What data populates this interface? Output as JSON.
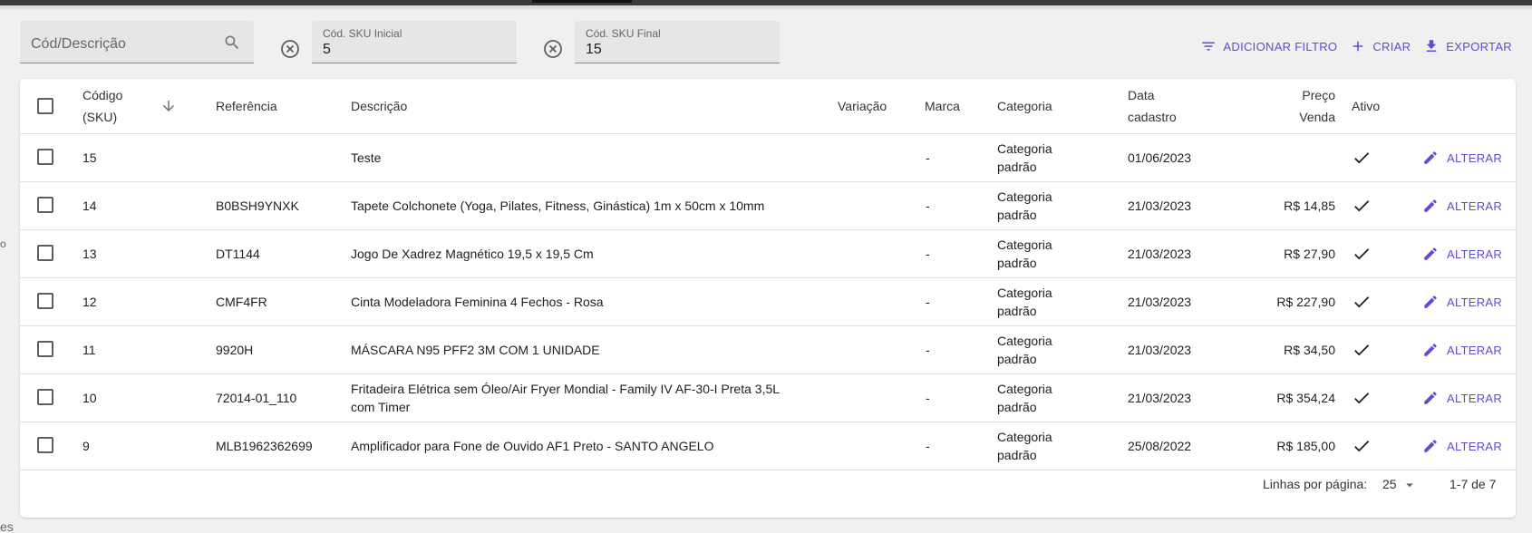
{
  "filters": {
    "search": {
      "placeholder": "Cód/Descrição"
    },
    "sku_start": {
      "label": "Cód. SKU Inicial",
      "value": "5"
    },
    "sku_end": {
      "label": "Cód. SKU Final",
      "value": "15"
    }
  },
  "actions": {
    "add_filter": "ADICIONAR FILTRO",
    "create": "CRIAR",
    "export": "EXPORTAR"
  },
  "side_fragments": {
    "fragment_1": "o",
    "fragment_2": "es"
  },
  "table": {
    "headers": {
      "code_line1": "Código",
      "code_line2": "(SKU)",
      "reference": "Referência",
      "description": "Descrição",
      "variation": "Variação",
      "brand": "Marca",
      "category": "Categoria",
      "date_line1": "Data",
      "date_line2": "cadastro",
      "price_line1": "Preço",
      "price_line2": "Venda",
      "active": "Ativo"
    },
    "rows": [
      {
        "code": "15",
        "reference": "",
        "description_l1": "Teste",
        "description_l2": "",
        "brand": "-",
        "category_l1": "Categoria",
        "category_l2": "padrão",
        "date": "01/06/2023",
        "price": "",
        "active": true,
        "action": "ALTERAR"
      },
      {
        "code": "14",
        "reference": "B0BSH9YNXK",
        "description_l1": "Tapete Colchonete (Yoga, Pilates, Fitness, Ginástica) 1m x 50cm x 10mm",
        "description_l2": "",
        "brand": "-",
        "category_l1": "Categoria",
        "category_l2": "padrão",
        "date": "21/03/2023",
        "price": "R$ 14,85",
        "active": true,
        "action": "ALTERAR"
      },
      {
        "code": "13",
        "reference": "DT1144",
        "description_l1": "Jogo De Xadrez Magnético 19,5 x 19,5 Cm",
        "description_l2": "",
        "brand": "-",
        "category_l1": "Categoria",
        "category_l2": "padrão",
        "date": "21/03/2023",
        "price": "R$ 27,90",
        "active": true,
        "action": "ALTERAR"
      },
      {
        "code": "12",
        "reference": "CMF4FR",
        "description_l1": "Cinta Modeladora Feminina 4 Fechos - Rosa",
        "description_l2": "",
        "brand": "-",
        "category_l1": "Categoria",
        "category_l2": "padrão",
        "date": "21/03/2023",
        "price": "R$ 227,90",
        "active": true,
        "action": "ALTERAR"
      },
      {
        "code": "11",
        "reference": "9920H",
        "description_l1": "MÁSCARA N95 PFF2 3M COM 1 UNIDADE",
        "description_l2": "",
        "brand": "-",
        "category_l1": "Categoria",
        "category_l2": "padrão",
        "date": "21/03/2023",
        "price": "R$ 34,50",
        "active": true,
        "action": "ALTERAR"
      },
      {
        "code": "10",
        "reference": "72014-01_110",
        "description_l1": "Fritadeira Elétrica sem Óleo/Air Fryer Mondial - Family IV AF-30-I Preta 3,5L",
        "description_l2": "com Timer",
        "brand": "-",
        "category_l1": "Categoria",
        "category_l2": "padrão",
        "date": "21/03/2023",
        "price": "R$ 354,24",
        "active": true,
        "action": "ALTERAR"
      },
      {
        "code": "9",
        "reference": "MLB1962362699",
        "description_l1": "Amplificador para Fone de Ouvido AF1 Preto - SANTO ANGELO",
        "description_l2": "",
        "brand": "-",
        "category_l1": "Categoria",
        "category_l2": "padrão",
        "date": "25/08/2022",
        "price": "R$ 185,00",
        "active": true,
        "action": "ALTERAR"
      }
    ]
  },
  "pagination": {
    "rows_per_page_label": "Linhas por página:",
    "rows_per_page": "25",
    "range": "1-7 de 7"
  },
  "colors": {
    "accent": "#5a4fcf",
    "background": "#f0f0f0",
    "field_bg": "#e6e6e6"
  }
}
